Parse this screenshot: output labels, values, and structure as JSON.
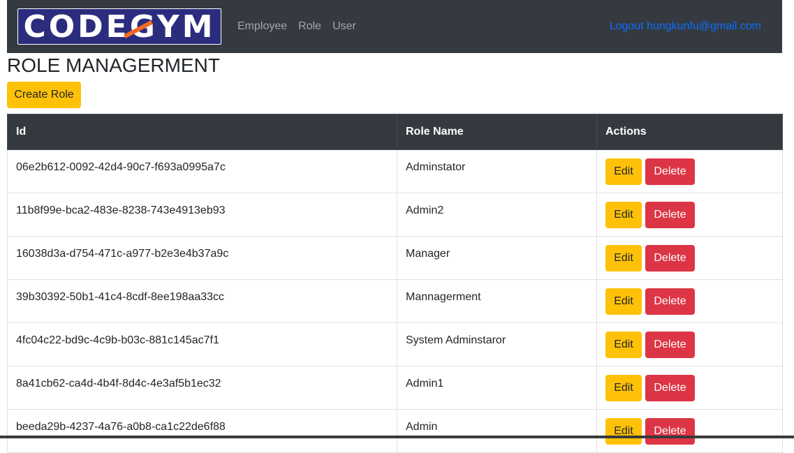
{
  "brand": {
    "logo_text": "CODEGYM"
  },
  "nav": {
    "links": [
      {
        "label": "Employee"
      },
      {
        "label": "Role"
      },
      {
        "label": "User"
      }
    ],
    "logout_label": "Logout hungkunfu@gmail.com"
  },
  "page": {
    "title": "ROLE MANAGERMENT",
    "create_button": "Create Role"
  },
  "table": {
    "headers": {
      "id": "Id",
      "role_name": "Role Name",
      "actions": "Actions"
    },
    "rows": [
      {
        "id": "06e2b612-0092-42d4-90c7-f693a0995a7c",
        "role_name": "Adminstator",
        "edit": "Edit",
        "delete": "Delete"
      },
      {
        "id": "11b8f99e-bca2-483e-8238-743e4913eb93",
        "role_name": "Admin2",
        "edit": "Edit",
        "delete": "Delete"
      },
      {
        "id": "16038d3a-d754-471c-a977-b2e3e4b37a9c",
        "role_name": "Manager",
        "edit": "Edit",
        "delete": "Delete"
      },
      {
        "id": "39b30392-50b1-41c4-8cdf-8ee198aa33cc",
        "role_name": "Mannagerment",
        "edit": "Edit",
        "delete": "Delete"
      },
      {
        "id": "4fc04c22-bd9c-4c9b-b03c-881c145ac7f1",
        "role_name": "System Adminstaror",
        "edit": "Edit",
        "delete": "Delete"
      },
      {
        "id": "8a41cb62-ca4d-4b4f-8d4c-4e3af5b1ec32",
        "role_name": "Admin1",
        "edit": "Edit",
        "delete": "Delete"
      },
      {
        "id": "beeda29b-4237-4a76-a0b8-ca1c22de6f88",
        "role_name": "Admin",
        "edit": "Edit",
        "delete": "Delete"
      }
    ]
  },
  "colors": {
    "navbar": "#343a40",
    "warning": "#ffc107",
    "danger": "#dc3545",
    "link": "#0d6efd",
    "logo_bg": "#2b2c7e",
    "logo_accent": "#f26a21"
  }
}
